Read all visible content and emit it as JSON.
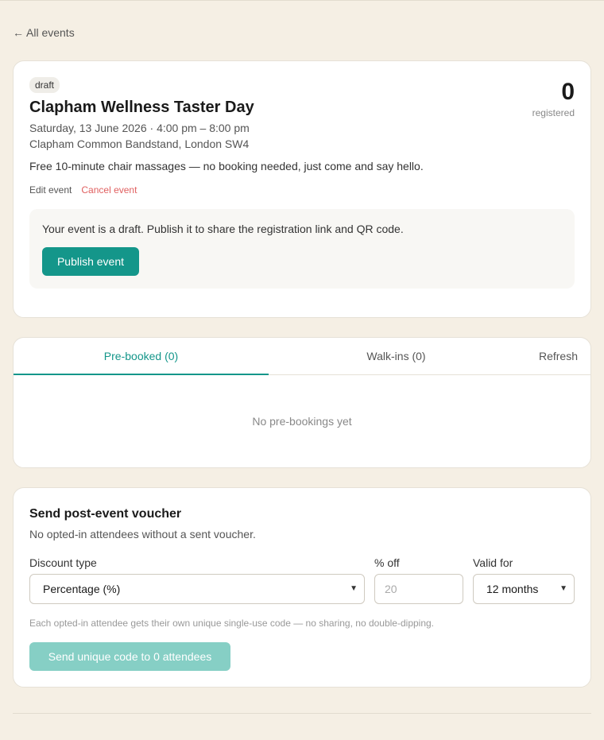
{
  "nav": {
    "back_arrow": "←",
    "back_label": "All events"
  },
  "event": {
    "status": "draft",
    "title": "Clapham Wellness Taster Day",
    "date": "Saturday, 13 June 2026 · 4:00 pm – 8:00 pm",
    "location": "Clapham Common Bandstand, London SW4",
    "description": "Free 10-minute chair massages — no booking needed, just come and say hello.",
    "edit_label": "Edit event",
    "cancel_label": "Cancel event",
    "registered_count": "0",
    "registered_label": "registered",
    "draft_message": "Your event is a draft. Publish it to share the registration link and QR code.",
    "publish_label": "Publish event"
  },
  "attendees": {
    "tabs": [
      {
        "label": "Pre-booked (0)",
        "active": true
      },
      {
        "label": "Walk-ins (0)",
        "active": false
      }
    ],
    "refresh_label": "Refresh",
    "empty_message": "No pre-bookings yet"
  },
  "voucher": {
    "title": "Send post-event voucher",
    "subtitle": "No opted-in attendees without a sent voucher.",
    "discount_type_label": "Discount type",
    "discount_type_value": "Percentage (%)",
    "percent_off_label": "% off",
    "percent_off_placeholder": "20",
    "valid_for_label": "Valid for",
    "valid_for_value": "12 months",
    "note": "Each opted-in attendee gets their own unique single-use code — no sharing, no double-dipping.",
    "send_label": "Send unique code to 0 attendees"
  },
  "colors": {
    "background": "#f5efe4",
    "accent": "#14968a",
    "accent_disabled": "#86cfc5",
    "danger": "#e06060"
  },
  "icons": {
    "back": "arrow-left-icon",
    "select": "chevron-down-icon"
  }
}
